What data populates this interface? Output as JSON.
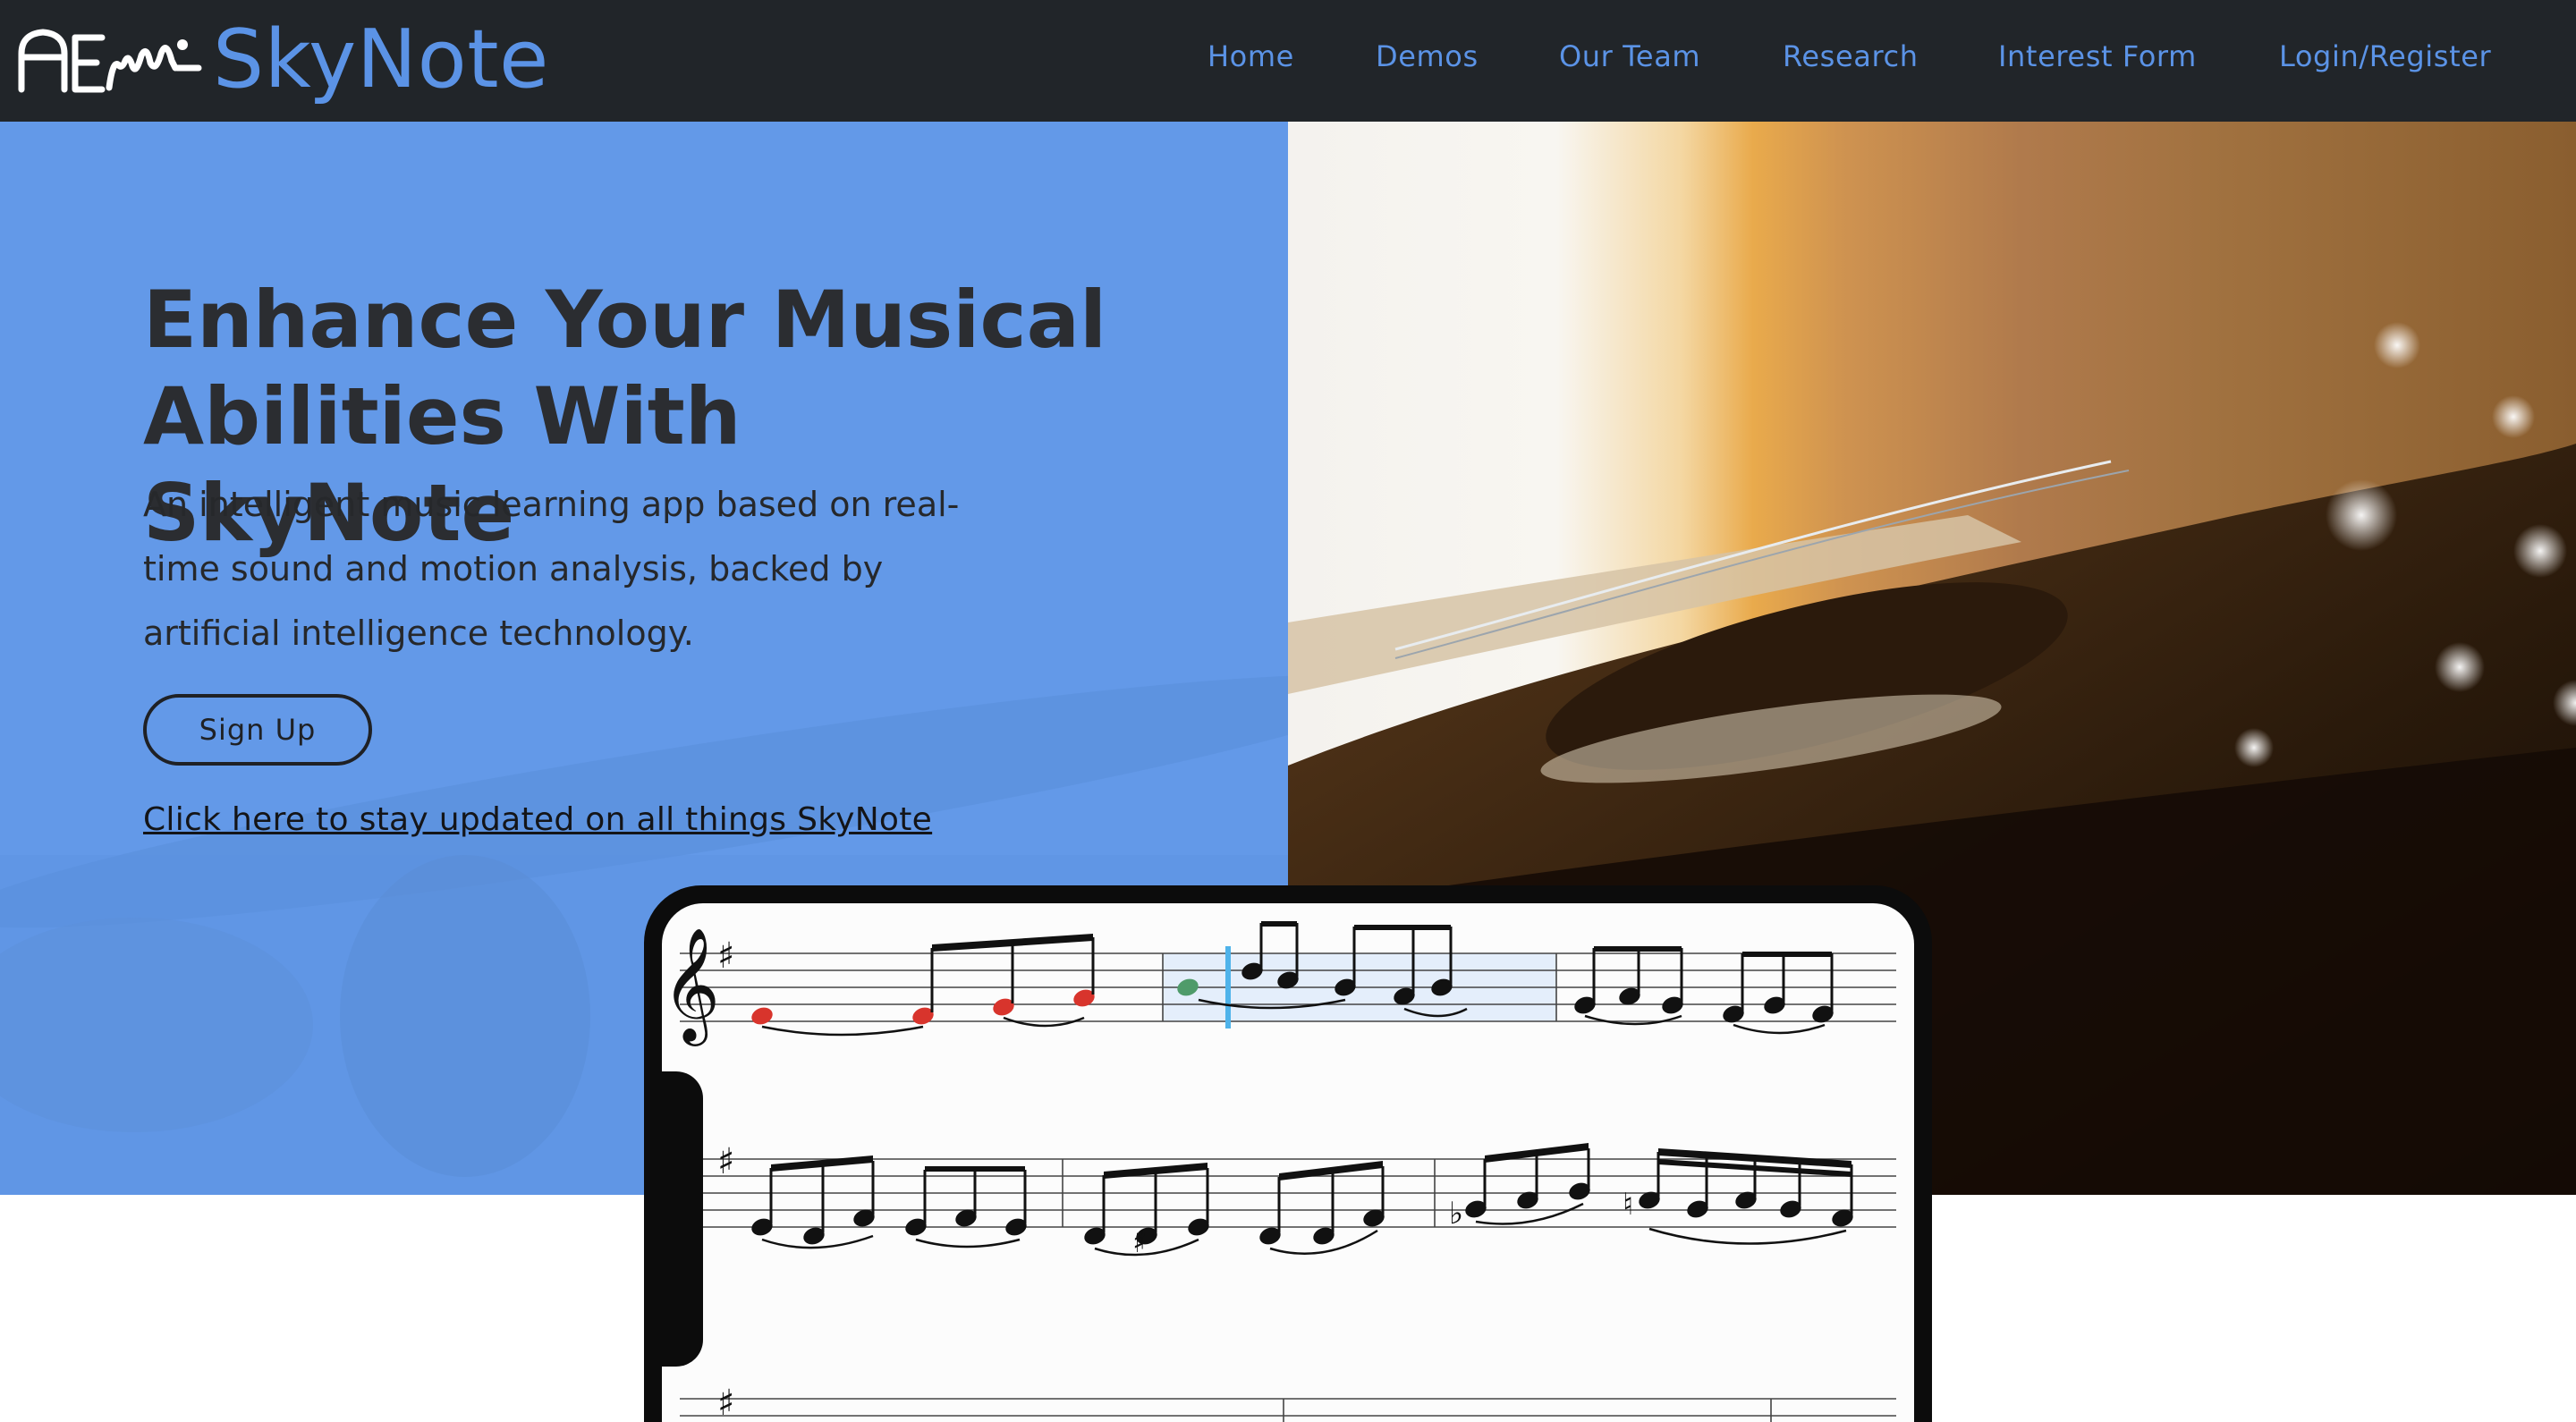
{
  "nav": {
    "brand": "SkyNote",
    "links": [
      "Home",
      "Demos",
      "Our Team",
      "Research",
      "Interest Form",
      "Login/Register"
    ]
  },
  "hero": {
    "title": "Enhance Your Musical Abilities With SkyNote",
    "subtitle": "An intelligent music learning app based on real-time sound and motion analysis, backed by artificial intelligence technology.",
    "signup_label": "Sign Up",
    "updates_link": "Click here to stay updated on all things SkyNote"
  },
  "colors": {
    "navbar_bg": "#212529",
    "accent_blue": "#5b93e6",
    "hero_blue": "#6399e8",
    "note_wrong": "#d8342c",
    "note_correct": "#4f9b6a",
    "playhead": "#4fb3ea",
    "highlight": "#e4eefb"
  },
  "icons": {
    "logo": "skynote-logo-icon"
  }
}
